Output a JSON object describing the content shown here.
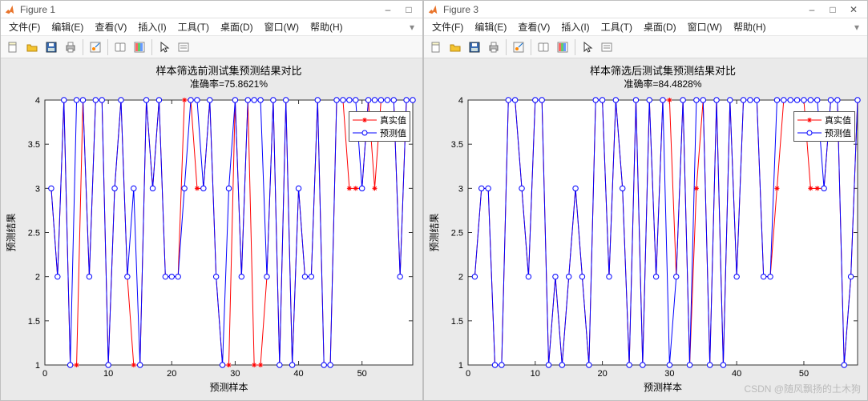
{
  "watermark": "CSDN @随风飘扬的土木狗",
  "menus": [
    "文件(F)",
    "编辑(E)",
    "查看(V)",
    "插入(I)",
    "工具(T)",
    "桌面(D)",
    "窗口(W)",
    "帮助(H)"
  ],
  "toolbar_icons": [
    "new-file-icon",
    "open-folder-icon",
    "save-icon",
    "print-icon",
    "sep",
    "data-cursor-icon",
    "sep",
    "link-icon",
    "insert-colorbar-icon",
    "sep",
    "pointer-icon",
    "properties-icon"
  ],
  "legend": {
    "real": "真实值",
    "pred": "预测值"
  },
  "figures": [
    {
      "id": "fig1",
      "title": "Figure 1",
      "win_btns": [
        "minimize",
        "maximize"
      ],
      "chart": {
        "title": "样本筛选前测试集预测结果对比",
        "subtitle": "准确率=75.8621%",
        "xlabel": "预测样本",
        "ylabel": "预测结果"
      }
    },
    {
      "id": "fig3",
      "title": "Figure 3",
      "win_btns": [
        "minimize",
        "maximize",
        "close"
      ],
      "chart": {
        "title": "样本筛选后测试集预测结果对比",
        "subtitle": "准确率=84.4828%",
        "xlabel": "预测样本",
        "ylabel": "预测结果"
      }
    }
  ],
  "chart_data": [
    {
      "type": "line",
      "title": "样本筛选前测试集预测结果对比",
      "subtitle": "准确率=75.8621%",
      "xlabel": "预测样本",
      "ylabel": "预测结果",
      "xlim": [
        0,
        58
      ],
      "ylim": [
        1,
        4
      ],
      "xticks": [
        0,
        10,
        20,
        30,
        40,
        50
      ],
      "yticks": [
        1,
        1.5,
        2,
        2.5,
        3,
        3.5,
        4
      ],
      "legend_pos": "top-right",
      "series": [
        {
          "name": "真实值",
          "color": "#ff0000",
          "marker": "asterisk",
          "values": [
            3,
            2,
            4,
            1,
            1,
            4,
            2,
            4,
            4,
            1,
            3,
            4,
            2,
            1,
            1,
            4,
            3,
            4,
            2,
            2,
            2,
            4,
            4,
            3,
            3,
            4,
            2,
            1,
            1,
            4,
            2,
            4,
            1,
            1,
            2,
            4,
            1,
            4,
            1,
            3,
            2,
            2,
            4,
            1,
            1,
            4,
            4,
            3,
            3,
            3,
            4,
            3,
            4,
            4,
            4,
            2,
            4,
            4
          ]
        },
        {
          "name": "预测值",
          "color": "#0000ff",
          "marker": "circle",
          "values": [
            3,
            2,
            4,
            1,
            4,
            4,
            2,
            4,
            4,
            1,
            3,
            4,
            2,
            3,
            1,
            4,
            3,
            4,
            2,
            2,
            2,
            3,
            4,
            4,
            3,
            4,
            2,
            1,
            3,
            4,
            2,
            4,
            4,
            4,
            2,
            4,
            1,
            4,
            1,
            3,
            2,
            2,
            4,
            1,
            1,
            4,
            4,
            4,
            4,
            3,
            4,
            4,
            4,
            4,
            4,
            2,
            4,
            4
          ]
        }
      ]
    },
    {
      "type": "line",
      "title": "样本筛选后测试集预测结果对比",
      "subtitle": "准确率=84.4828%",
      "xlabel": "预测样本",
      "ylabel": "预测结果",
      "xlim": [
        0,
        58
      ],
      "ylim": [
        1,
        4
      ],
      "xticks": [
        0,
        10,
        20,
        30,
        40,
        50
      ],
      "yticks": [
        1,
        1.5,
        2,
        2.5,
        3,
        3.5,
        4
      ],
      "legend_pos": "top-right",
      "series": [
        {
          "name": "真实值",
          "color": "#ff0000",
          "marker": "asterisk",
          "values": [
            2,
            3,
            3,
            1,
            1,
            4,
            4,
            3,
            2,
            4,
            4,
            1,
            2,
            1,
            2,
            3,
            2,
            1,
            4,
            4,
            2,
            4,
            3,
            1,
            4,
            1,
            4,
            2,
            4,
            4,
            2,
            4,
            1,
            3,
            4,
            1,
            4,
            1,
            4,
            2,
            4,
            4,
            4,
            2,
            2,
            3,
            4,
            4,
            4,
            4,
            3,
            3,
            3,
            4,
            4,
            1,
            2,
            4
          ]
        },
        {
          "name": "预测值",
          "color": "#0000ff",
          "marker": "circle",
          "values": [
            2,
            3,
            3,
            1,
            1,
            4,
            4,
            3,
            2,
            4,
            4,
            1,
            2,
            1,
            2,
            3,
            2,
            1,
            4,
            4,
            2,
            4,
            3,
            1,
            4,
            1,
            4,
            2,
            4,
            1,
            2,
            4,
            1,
            4,
            4,
            1,
            4,
            1,
            4,
            2,
            4,
            4,
            4,
            2,
            2,
            4,
            4,
            4,
            4,
            4,
            4,
            4,
            3,
            4,
            4,
            1,
            2,
            4
          ]
        }
      ]
    }
  ]
}
